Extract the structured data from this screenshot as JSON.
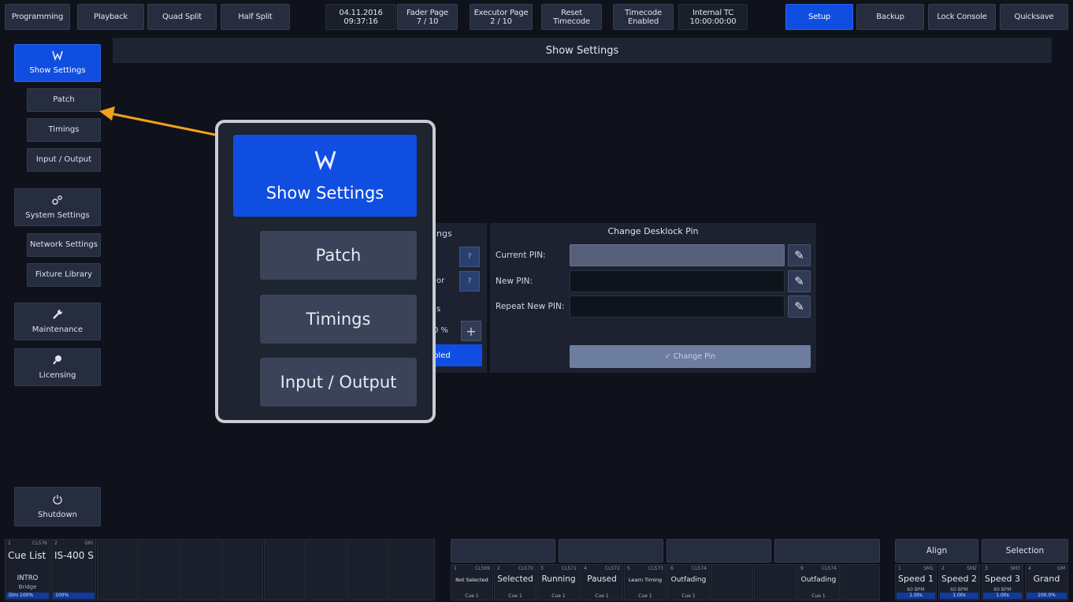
{
  "topbar": {
    "buttons": [
      "Programming",
      "Playback",
      "Quad Split",
      "Half Split"
    ],
    "date": "04.11.2016",
    "time": "09:37:16",
    "fader_page_label": "Fader Page",
    "fader_page_value": "7 / 10",
    "executor_page_label": "Executor Page",
    "executor_page_value": "2 / 10",
    "reset_line1": "Reset",
    "reset_line2": "Timecode",
    "timecode_line1": "Timecode",
    "timecode_line2": "Enabled",
    "internal_tc_label": "Internal TC",
    "internal_tc_value": "10:00:00:00",
    "setup": "Setup",
    "backup": "Backup",
    "lock": "Lock Console",
    "quicksave": "Quicksave"
  },
  "sidebar": {
    "show_settings": "Show Settings",
    "patch": "Patch",
    "timings": "Timings",
    "input_output": "Input / Output",
    "system_settings": "System Settings",
    "network_settings": "Network Settings",
    "fixture_library": "Fixture Library",
    "maintenance": "Maintenance",
    "licensing": "Licensing",
    "shutdown": "Shutdown"
  },
  "main": {
    "title": "Show Settings",
    "partial_left": {
      "header": "ngs",
      "row2": "or",
      "section": "s",
      "percent": "0 %",
      "enabled": "abled",
      "q": "?"
    },
    "pin": {
      "header": "Change Desklock Pin",
      "current": "Current PIN:",
      "new": "New PIN:",
      "repeat": "Repeat New PIN:",
      "change": "✓ Change Pin"
    }
  },
  "zoom": {
    "show_settings": "Show Settings",
    "patch": "Patch",
    "timings": "Timings",
    "input_output": "Input / Output"
  },
  "bottom": {
    "cl_num": "1",
    "cl_id": "CL576",
    "cl_name": "Cue List",
    "cl_cue": "INTRO",
    "cl_sub": "Bridge",
    "cl_bar": "Dim 100%",
    "g_num": "2",
    "g_id": "GRI",
    "g_name": "IS-400 S",
    "g_bar": "100%",
    "exec": [
      {
        "num": "1",
        "id": "CL569",
        "state": "Not Selected",
        "cue": "Cue 1"
      },
      {
        "num": "2",
        "id": "CL570",
        "state": "Selected",
        "cue": "Cue 1"
      },
      {
        "num": "3",
        "id": "CL571",
        "state": "Running",
        "cue": "Cue 1"
      },
      {
        "num": "4",
        "id": "CL572",
        "state": "Paused",
        "cue": "Cue 1"
      },
      {
        "num": "5",
        "id": "CL573",
        "state": "Learn Timing",
        "cue": "Cue 1"
      },
      {
        "num": "6",
        "id": "CL574",
        "state": "Outfading",
        "cue": "Cue 1"
      }
    ],
    "exec9": {
      "num": "9",
      "id": "CL574",
      "state": "Outfading",
      "cue": "Cue 1"
    },
    "align": "Align",
    "selection": "Selection",
    "speeds": [
      {
        "num": "1",
        "id": "SM1",
        "name": "Speed 1",
        "bpm": "60 BPM",
        "bar": "1.00s"
      },
      {
        "num": "2",
        "id": "SM2",
        "name": "Speed 2",
        "bpm": "60 BPM",
        "bar": "1.00s"
      },
      {
        "num": "3",
        "id": "SM3",
        "name": "Speed 3",
        "bpm": "60 BPM",
        "bar": "1.00s"
      },
      {
        "num": "4",
        "id": "GM",
        "name": "Grand",
        "bpm": "",
        "bar": "100.0%"
      }
    ]
  },
  "colors": {
    "accent": "#0f4ee0",
    "arrow": "#f0a020"
  }
}
